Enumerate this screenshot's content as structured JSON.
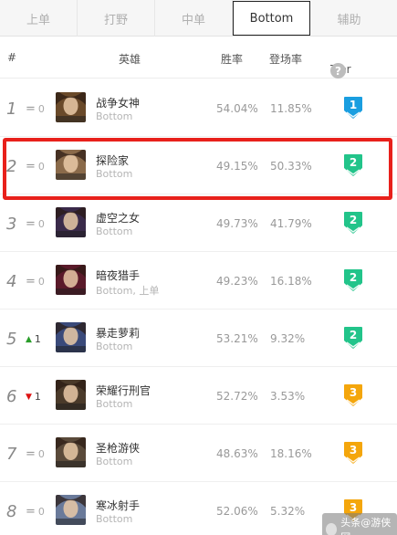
{
  "tabs": [
    {
      "label": "上单"
    },
    {
      "label": "打野"
    },
    {
      "label": "中单"
    },
    {
      "label": "Bottom"
    },
    {
      "label": "辅助"
    }
  ],
  "active_tab": "Bottom",
  "header": {
    "num": "#",
    "champion": "英雄",
    "win_rate": "胜率",
    "pick_rate": "登场率",
    "tier": "Tier",
    "help": "?"
  },
  "rows": [
    {
      "rank": "1",
      "change_type": "same",
      "change": "0",
      "name": "战争女神",
      "role": "Bottom",
      "win": "54.04%",
      "pick": "11.85%",
      "tier": "1",
      "tier_color": "#1a9ee0",
      "avatar_color": "#6a4a2a"
    },
    {
      "rank": "2",
      "change_type": "same",
      "change": "0",
      "name": "探险家",
      "role": "Bottom",
      "win": "49.15%",
      "pick": "50.33%",
      "tier": "2",
      "tier_color": "#22c48a",
      "avatar_color": "#8a6a4a"
    },
    {
      "rank": "3",
      "change_type": "same",
      "change": "0",
      "name": "虚空之女",
      "role": "Bottom",
      "win": "49.73%",
      "pick": "41.79%",
      "tier": "2",
      "tier_color": "#22c48a",
      "avatar_color": "#3a2a4a"
    },
    {
      "rank": "4",
      "change_type": "same",
      "change": "0",
      "name": "暗夜猎手",
      "role": "Bottom, 上单",
      "win": "49.23%",
      "pick": "16.18%",
      "tier": "2",
      "tier_color": "#22c48a",
      "avatar_color": "#5a1a2a"
    },
    {
      "rank": "5",
      "change_type": "up",
      "change": "1",
      "name": "暴走萝莉",
      "role": "Bottom",
      "win": "53.21%",
      "pick": "9.32%",
      "tier": "2",
      "tier_color": "#22c48a",
      "avatar_color": "#3a4a7a"
    },
    {
      "rank": "6",
      "change_type": "down",
      "change": "1",
      "name": "荣耀行刑官",
      "role": "Bottom",
      "win": "52.72%",
      "pick": "3.53%",
      "tier": "3",
      "tier_color": "#f4a60c",
      "avatar_color": "#4a3a2a"
    },
    {
      "rank": "7",
      "change_type": "same",
      "change": "0",
      "name": "圣枪游侠",
      "role": "Bottom",
      "win": "48.63%",
      "pick": "18.16%",
      "tier": "3",
      "tier_color": "#f4a60c",
      "avatar_color": "#5a4a3a"
    },
    {
      "rank": "8",
      "change_type": "same",
      "change": "0",
      "name": "寒冰射手",
      "role": "Bottom",
      "win": "52.06%",
      "pick": "5.32%",
      "tier": "3",
      "tier_color": "#f4a60c",
      "avatar_color": "#6a7a9a"
    }
  ],
  "icons": {
    "same": "equals-icon",
    "up": "arrow-up-icon",
    "down": "arrow-down-icon"
  },
  "watermark": {
    "text": "头条@游侠网"
  }
}
